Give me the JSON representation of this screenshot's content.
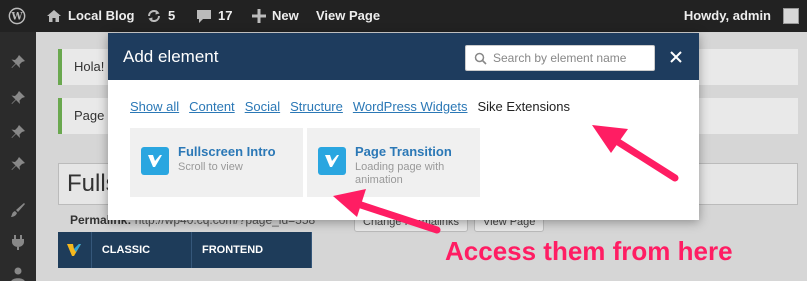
{
  "adminbar": {
    "site_name": "Local Blog",
    "updates_count": "5",
    "comments_count": "17",
    "new_label": "New",
    "view_page_label": "View Page",
    "howdy": "Howdy, admin"
  },
  "page": {
    "notice1": "Hola!",
    "notice2": "Page",
    "title_value": "Fulls",
    "permalink_label": "Permalink:",
    "permalink_url": "http://wp40.cq.com/?page_id=558",
    "change_permalinks": "Change Permalinks",
    "view_page_button": "View Page"
  },
  "vc": {
    "classic_mode": "CLASSIC MODE",
    "frontend_editor": "FRONTEND EDITOR"
  },
  "modal": {
    "title": "Add element",
    "search_placeholder": "Search by element name",
    "tabs": [
      {
        "label": "Show all"
      },
      {
        "label": "Content"
      },
      {
        "label": "Social"
      },
      {
        "label": "Structure"
      },
      {
        "label": "WordPress Widgets"
      },
      {
        "label": "Sike Extensions"
      }
    ],
    "elements": [
      {
        "name": "Fullscreen Intro",
        "desc": "Scroll to view"
      },
      {
        "name": "Page Transition",
        "desc": "Loading page with animation"
      }
    ]
  },
  "annotation": {
    "callout": "Access them from here",
    "color": "#ff1d63"
  },
  "colors": {
    "modal_header": "#1e3c5e",
    "link": "#2b78b6",
    "element_icon": "#2aa6e0"
  }
}
